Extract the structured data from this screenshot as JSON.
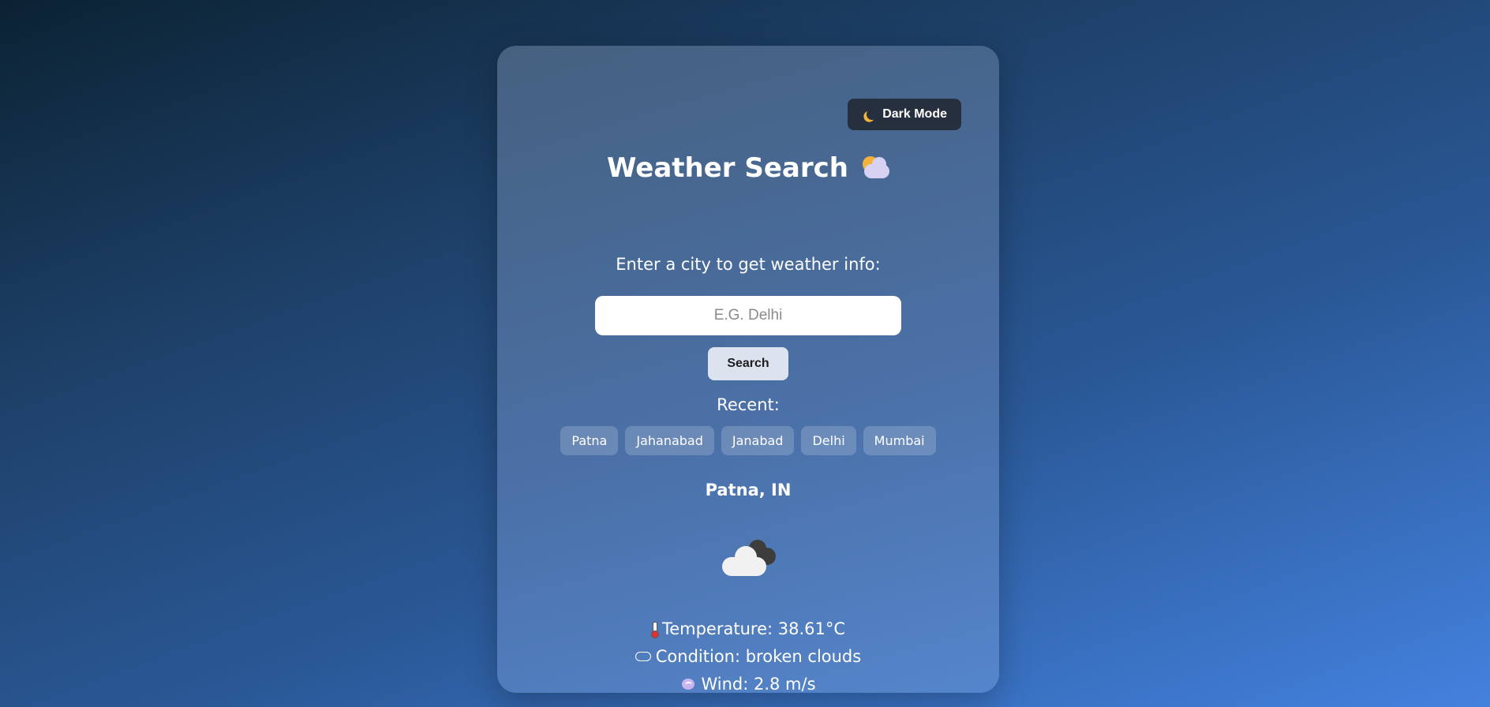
{
  "theme_toggle": {
    "label": "Dark Mode",
    "icon": "moon-icon"
  },
  "header": {
    "title": "Weather Search",
    "title_icon": "sun-behind-cloud-icon"
  },
  "search": {
    "prompt": "Enter a city to get weather info:",
    "placeholder": "E.G. Delhi",
    "value": "",
    "button_label": "Search"
  },
  "recent": {
    "label": "Recent:",
    "cities": [
      "Patna",
      "Jahanabad",
      "Janabad",
      "Delhi",
      "Mumbai"
    ]
  },
  "result": {
    "location": "Patna, IN",
    "weather_icon": "broken-clouds-icon",
    "temperature": "Temperature: 38.61°C",
    "condition": "Condition: broken clouds",
    "wind": "Wind: 2.8 m/s"
  },
  "colors": {
    "card_accent": "#4e74ac",
    "toggle_bg": "#262f3e",
    "search_button_bg": "#dce3ee"
  }
}
